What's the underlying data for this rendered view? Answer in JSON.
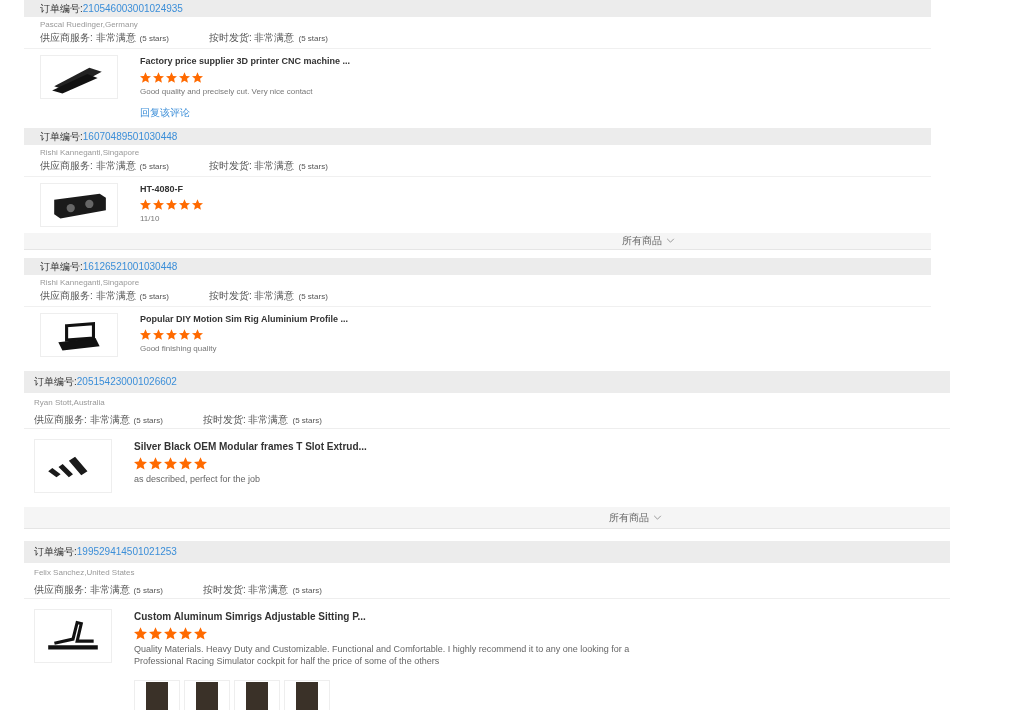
{
  "orders": [
    {
      "kind": "compact",
      "order_label": "订单编号:",
      "order_number": "210546003001024935",
      "reviewer": "Pascal Ruedinger,Germany",
      "ratings": [
        {
          "label": "供应商服务:",
          "value": "非常满意",
          "stars_text": "(5 stars)"
        },
        {
          "label": "按时发货:",
          "value": "非常满意",
          "stars_text": "(5 stars)"
        }
      ],
      "product": {
        "title": "Factory price supplier 3D printer CNC machine ...",
        "stars": 5,
        "comment": "Good quality and precisely cut. Very nice contact"
      },
      "reply_link": "回复该评论"
    },
    {
      "kind": "compact",
      "order_label": "订单编号:",
      "order_number": "16070489501030448",
      "reviewer": "Rishi Kanneganti,Singapore",
      "ratings": [
        {
          "label": "供应商服务:",
          "value": "非常满意",
          "stars_text": "(5 stars)"
        },
        {
          "label": "按时发货:",
          "value": "非常满意",
          "stars_text": "(5 stars)"
        }
      ],
      "product": {
        "title": "HT-4080-F",
        "stars": 5,
        "comment": "11/10"
      },
      "footer": "所有商品"
    },
    {
      "kind": "compact",
      "order_label": "订单编号:",
      "order_number": "16126521001030448",
      "reviewer": "Rishi Kanneganti,Singapore",
      "ratings": [
        {
          "label": "供应商服务:",
          "value": "非常满意",
          "stars_text": "(5 stars)"
        },
        {
          "label": "按时发货:",
          "value": "非常满意",
          "stars_text": "(5 stars)"
        }
      ],
      "product": {
        "title": "Popular DIY Motion Sim Rig Aluminium Profile ...",
        "stars": 5,
        "comment": "Good finishing quality"
      }
    },
    {
      "kind": "regular",
      "order_label": "订单编号:",
      "order_number": "205154230001026602",
      "reviewer": "Ryan Stott,Australia",
      "ratings": [
        {
          "label": "供应商服务:",
          "value": "非常满意",
          "stars_text": "(5 stars)"
        },
        {
          "label": "按时发货:",
          "value": "非常满意",
          "stars_text": "(5 stars)"
        }
      ],
      "product": {
        "title": "Silver Black OEM Modular frames T Slot Extrud...",
        "stars": 5,
        "comment": "as described, perfect for the job"
      },
      "footer": "所有商品"
    },
    {
      "kind": "regular",
      "order_label": "订单编号:",
      "order_number": "199529414501021253",
      "reviewer": "Felix Sanchez,United States",
      "ratings": [
        {
          "label": "供应商服务:",
          "value": "非常满意",
          "stars_text": "(5 stars)"
        },
        {
          "label": "按时发货:",
          "value": "非常满意",
          "stars_text": "(5 stars)"
        }
      ],
      "product": {
        "title": "Custom Aluminum Simrigs Adjustable Sitting P...",
        "stars": 5,
        "comment": "Quality Materials. Heavy Duty and Customizable. Functional and Comfortable. I highly recommend it to any one looking for a Professional Racing Simulator cockpit for half the price of some of the others"
      },
      "review_photos": [
        {
          "kind": "photo"
        },
        {
          "kind": "photo"
        },
        {
          "kind": "photo"
        },
        {
          "kind": "photo"
        }
      ]
    }
  ]
}
